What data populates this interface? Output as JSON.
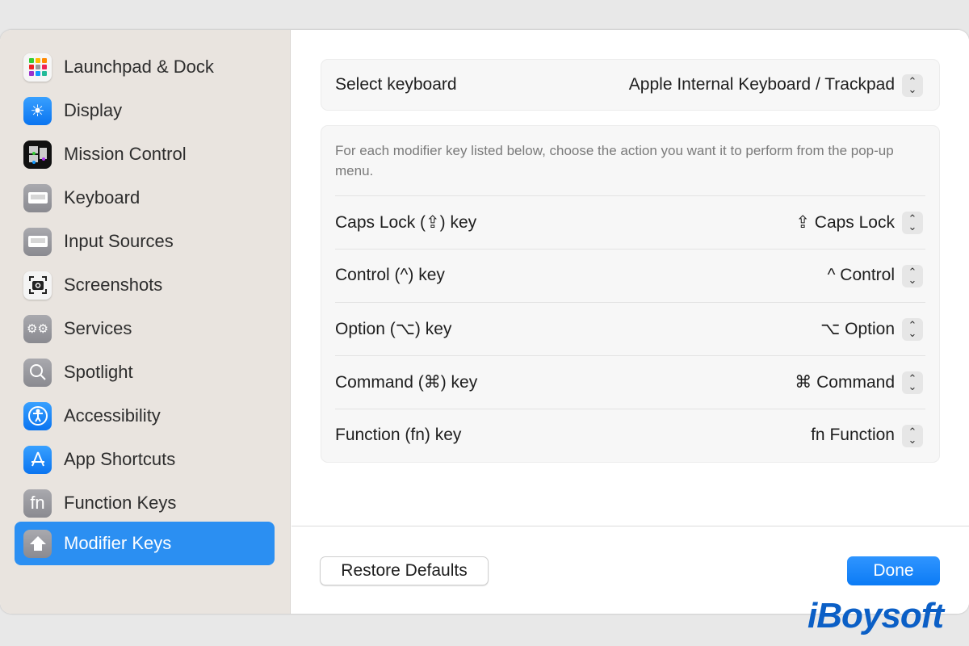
{
  "sidebar": {
    "items": [
      {
        "label": "Launchpad & Dock",
        "icon": "launchpad-icon"
      },
      {
        "label": "Display",
        "icon": "sun-icon"
      },
      {
        "label": "Mission Control",
        "icon": "mission-control-icon"
      },
      {
        "label": "Keyboard",
        "icon": "keyboard-icon"
      },
      {
        "label": "Input Sources",
        "icon": "keyboard-icon"
      },
      {
        "label": "Screenshots",
        "icon": "camera-icon"
      },
      {
        "label": "Services",
        "icon": "gears-icon"
      },
      {
        "label": "Spotlight",
        "icon": "magnifier-icon"
      },
      {
        "label": "Accessibility",
        "icon": "accessibility-icon"
      },
      {
        "label": "App Shortcuts",
        "icon": "app-store-icon"
      },
      {
        "label": "Function Keys",
        "icon": "fn-icon",
        "glyph": "fn"
      },
      {
        "label": "Modifier Keys",
        "icon": "shift-arrow-icon",
        "selected": true
      }
    ]
  },
  "keyboard": {
    "label": "Select keyboard",
    "value": "Apple Internal Keyboard / Trackpad"
  },
  "description": "For each modifier key listed below, choose the action you want it to perform from the pop-up menu.",
  "modifiers": [
    {
      "label": "Caps Lock (⇪) key",
      "value": "⇪ Caps Lock"
    },
    {
      "label": "Control (^) key",
      "value": "^ Control"
    },
    {
      "label": "Option (⌥) key",
      "value": "⌥ Option"
    },
    {
      "label": "Command (⌘) key",
      "value": "⌘ Command"
    },
    {
      "label": "Function (fn) key",
      "value": "fn Function"
    }
  ],
  "buttons": {
    "restore": "Restore Defaults",
    "done": "Done"
  },
  "watermark": "iBoysoft",
  "colors": {
    "accent": "#2b8ff2",
    "sidebar_bg": "#e9e4df"
  }
}
